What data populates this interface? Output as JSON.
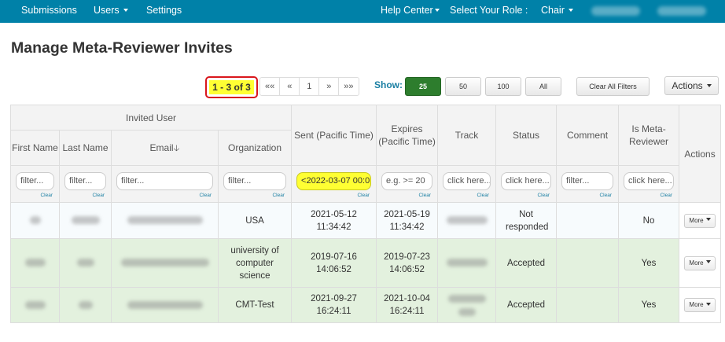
{
  "nav": {
    "submissions": "Submissions",
    "users": "Users",
    "settings": "Settings",
    "help_center": "Help Center",
    "select_role": "Select Your Role :",
    "role": "Chair"
  },
  "page": {
    "title": "Manage Meta-Reviewer Invites"
  },
  "toolbar": {
    "range": "1 - 3 of 3",
    "pager": [
      "««",
      "«",
      "1",
      "»",
      "»»"
    ],
    "show_label": "Show:",
    "sizes": [
      "25",
      "50",
      "100",
      "All"
    ],
    "active_size": "25",
    "clear_filters": "Clear All Filters",
    "actions": "Actions"
  },
  "table": {
    "group_header": "Invited User",
    "columns": {
      "first_name": "First Name",
      "last_name": "Last Name",
      "email": "Email",
      "organization": "Organization",
      "sent": "Sent (Pacific Time)",
      "expires": "Expires (Pacific Time)",
      "track": "Track",
      "status": "Status",
      "comment": "Comment",
      "is_meta": "Is Meta-Reviewer",
      "actions": "Actions"
    },
    "filters": {
      "first_name": "filter...",
      "last_name": "filter...",
      "email": "filter...",
      "organization": "filter...",
      "sent": "<2022-03-07 00:0",
      "expires": "e.g. >= 20",
      "track": "click here...",
      "status": "click here...",
      "comment": "filter...",
      "is_meta": "click here...",
      "clear": "Clear"
    },
    "rows": [
      {
        "organization": "USA",
        "sent": "2021-05-12 11:34:42",
        "expires": "2021-05-19 11:34:42",
        "status": "Not responded",
        "is_meta": "No",
        "more": "More"
      },
      {
        "organization": "university of computer science",
        "sent": "2019-07-16 14:06:52",
        "expires": "2019-07-23 14:06:52",
        "status": "Accepted",
        "is_meta": "Yes",
        "more": "More"
      },
      {
        "organization": "CMT-Test",
        "sent": "2021-09-27 16:24:11",
        "expires": "2021-10-04 16:24:11",
        "status": "Accepted",
        "is_meta": "Yes",
        "more": "More"
      }
    ]
  },
  "colors": {
    "navbar": "#0081a8",
    "highlight": "#ffff33",
    "highlight_border": "#d9161c",
    "active_button": "#2d7d2d",
    "accepted_row": "#e3f1de",
    "link": "#1a7fa3"
  }
}
